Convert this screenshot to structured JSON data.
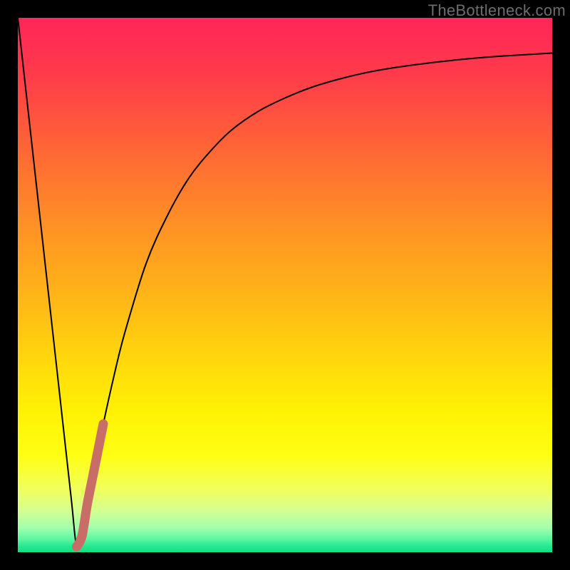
{
  "watermark": "TheBottleneck.com",
  "colors": {
    "frame": "#000000",
    "curve": "#000000",
    "highlight": "#c96e66",
    "gradient_top": "#ff2559",
    "gradient_bottom": "#13df85"
  },
  "chart_data": {
    "type": "line",
    "title": "",
    "xlabel": "",
    "ylabel": "",
    "xlim": [
      0,
      100
    ],
    "ylim": [
      0,
      100
    ],
    "grid": false,
    "legend": false,
    "series": [
      {
        "name": "bottleneck-curve",
        "color": "#000000",
        "x": [
          0,
          2,
          4,
          6,
          8,
          10,
          11,
          12,
          14,
          16,
          18,
          20,
          24,
          28,
          32,
          36,
          40,
          45,
          50,
          55,
          60,
          65,
          70,
          75,
          80,
          85,
          90,
          95,
          100
        ],
        "y": [
          100,
          82,
          64,
          46,
          28,
          10,
          1,
          3,
          14,
          24,
          33,
          41,
          54,
          63,
          70,
          75,
          79,
          82.5,
          85,
          87,
          88.5,
          89.7,
          90.6,
          91.3,
          91.9,
          92.4,
          92.8,
          93.1,
          93.4
        ]
      },
      {
        "name": "highlight-segment",
        "color": "#c96e66",
        "x": [
          11,
          12,
          13,
          14,
          15,
          16
        ],
        "y": [
          1,
          3,
          9,
          14,
          19,
          24
        ]
      }
    ]
  }
}
